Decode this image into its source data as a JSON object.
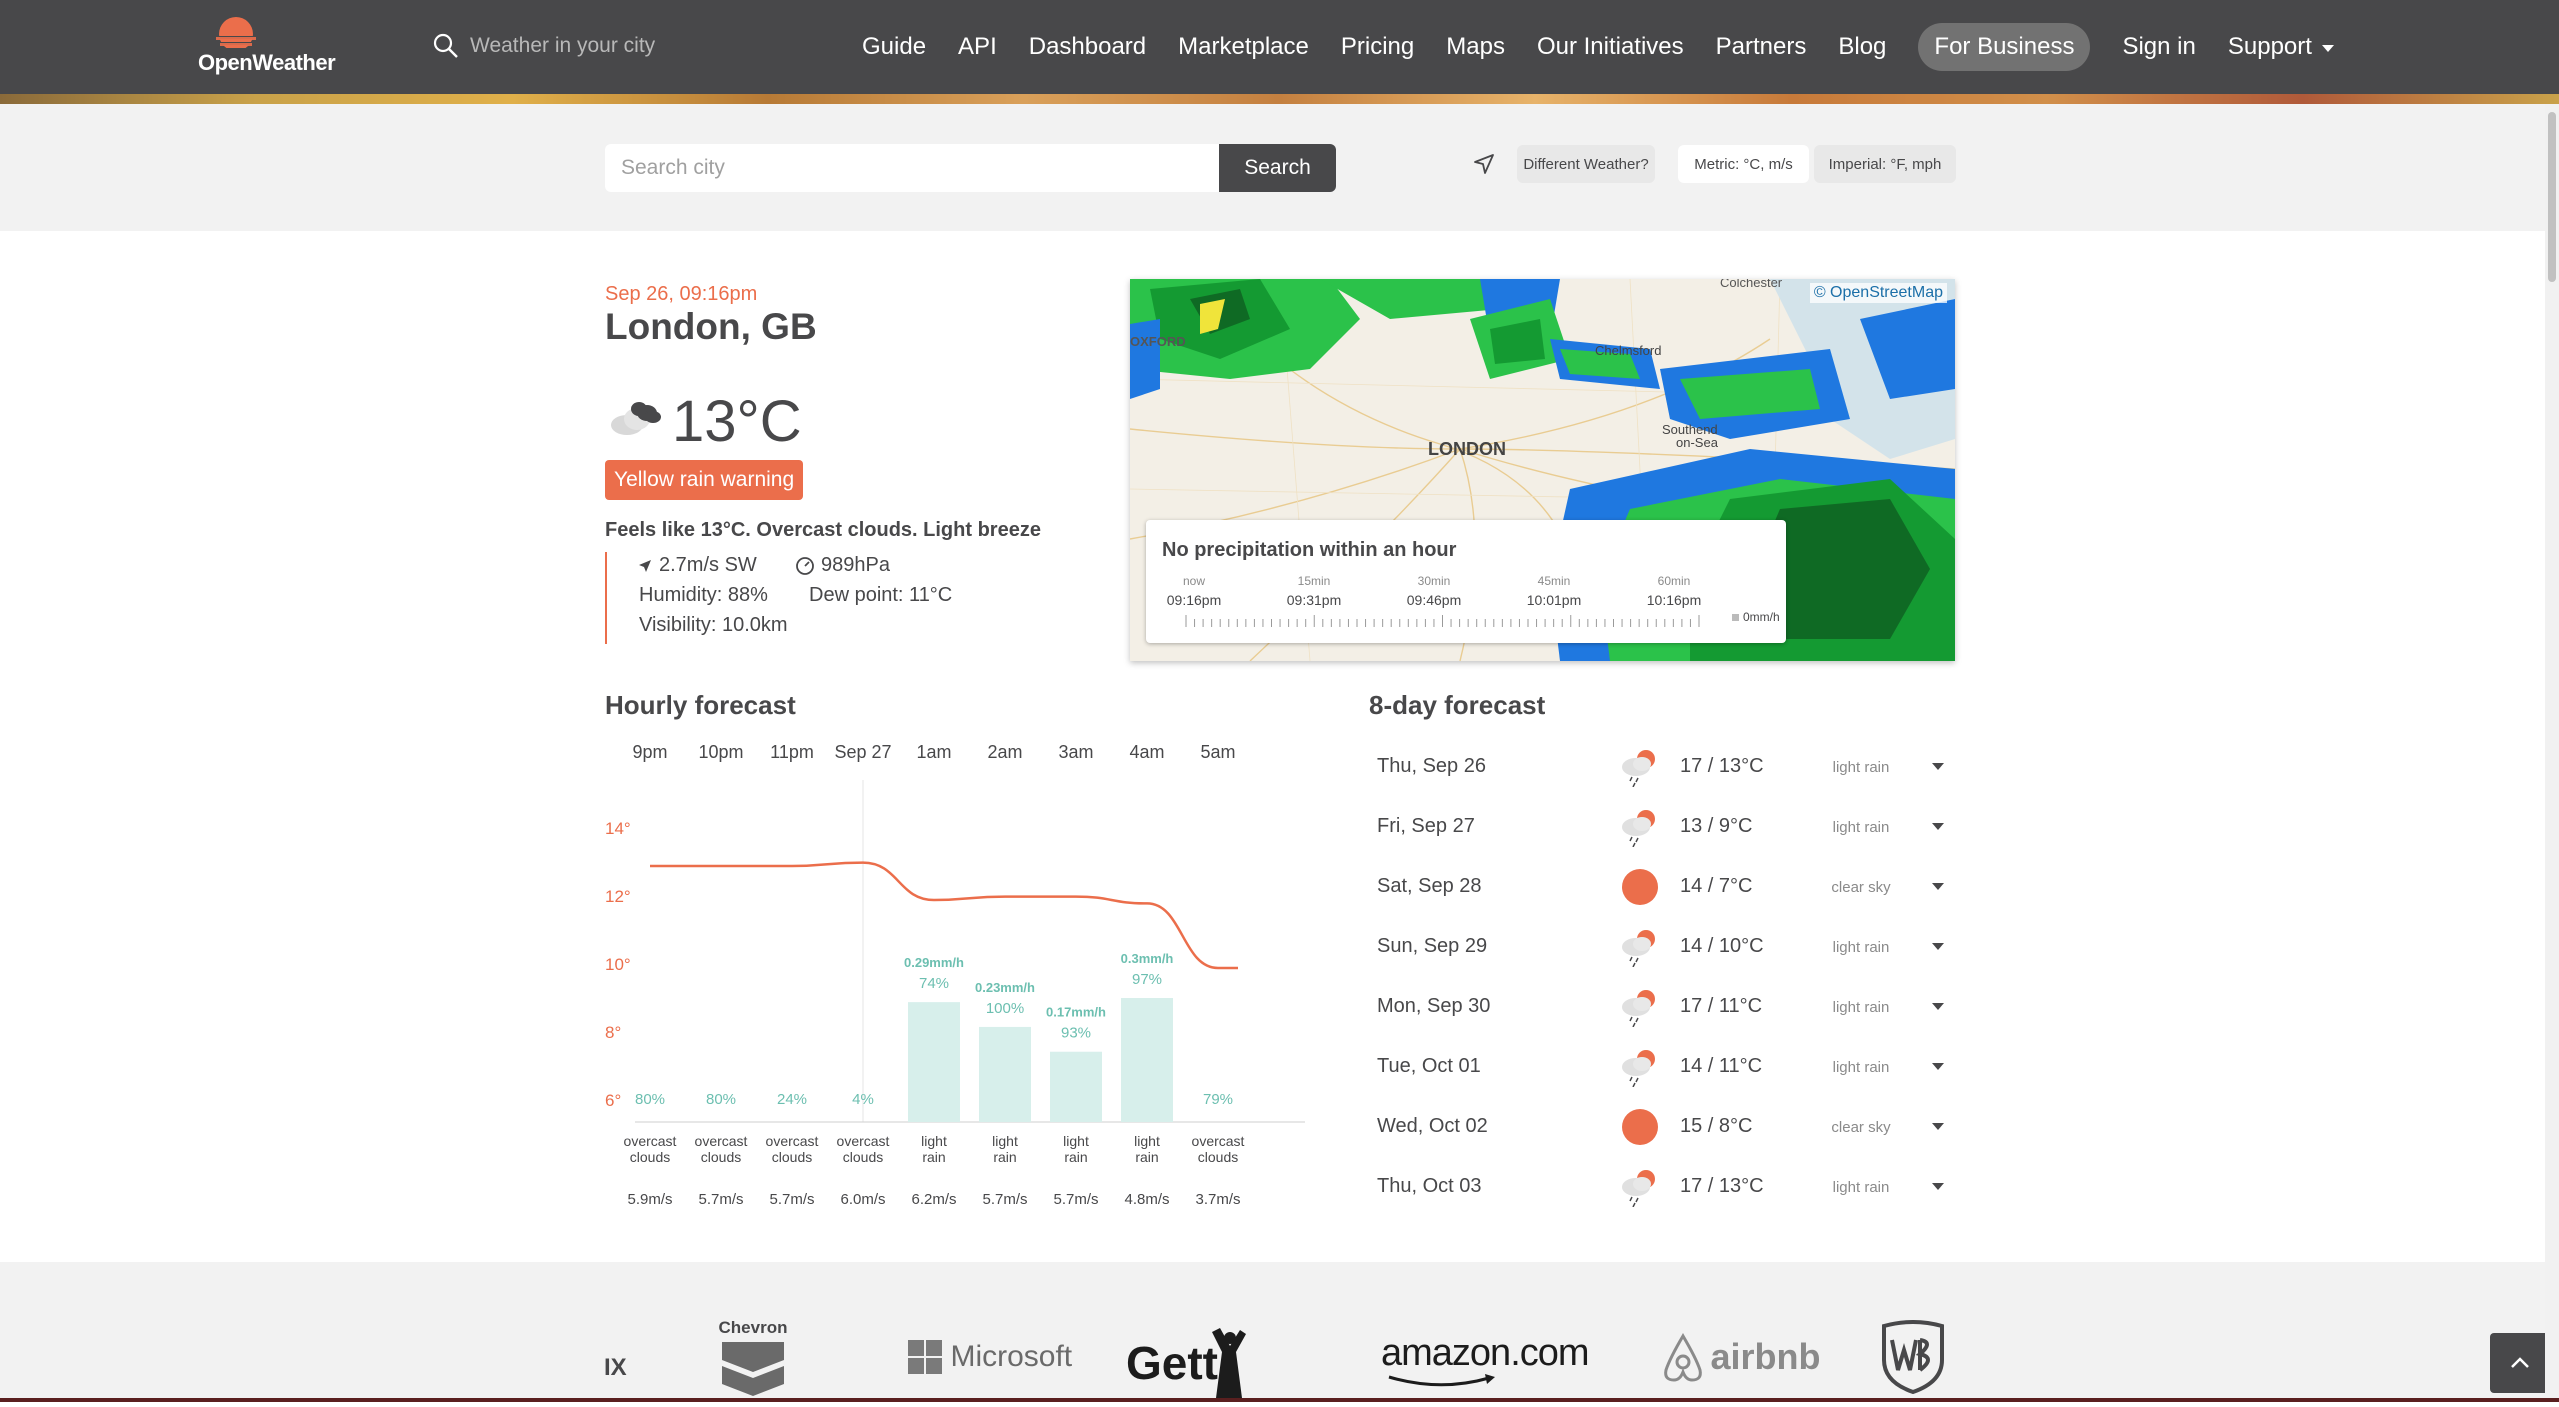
{
  "nav": {
    "logo_text": "OpenWeather",
    "search_placeholder": "Weather in your city",
    "links": [
      "Guide",
      "API",
      "Dashboard",
      "Marketplace",
      "Pricing",
      "Maps",
      "Our Initiatives",
      "Partners",
      "Blog"
    ],
    "business": "For Business",
    "sign_in": "Sign in",
    "support": "Support"
  },
  "search": {
    "placeholder": "Search city",
    "button": "Search",
    "different_weather": "Different Weather?",
    "metric": "Metric: °C, m/s",
    "imperial": "Imperial: °F, mph"
  },
  "current": {
    "datetime": "Sep 26, 09:16pm",
    "city": "London, GB",
    "temp": "13°C",
    "warning": "Yellow rain warning",
    "feels_like": "Feels like 13°C. Overcast clouds. Light breeze",
    "wind": "2.7m/s SW",
    "pressure": "989hPa",
    "humidity": "Humidity: 88%",
    "dew_point": "Dew point: 11°C",
    "visibility": "Visibility: 10.0km"
  },
  "map": {
    "attribution": "© OpenStreetMap",
    "places": [
      "Colchester",
      "OXFORD",
      "Chelmsford",
      "LONDON",
      "Southend",
      "on-Sea"
    ],
    "precip_title": "No precipitation within an hour",
    "precip_labels": [
      "now",
      "15min",
      "30min",
      "45min",
      "60min"
    ],
    "precip_times": [
      "09:16pm",
      "09:31pm",
      "09:46pm",
      "10:01pm",
      "10:16pm"
    ],
    "precip_legend": "0mm/h"
  },
  "hourly": {
    "title": "Hourly forecast",
    "times": [
      "9pm",
      "10pm",
      "11pm",
      "Sep 27",
      "1am",
      "2am",
      "3am",
      "4am",
      "5am"
    ],
    "y_ticks": [
      "14°",
      "12°",
      "10°",
      "8°",
      "6°"
    ],
    "descriptions": [
      [
        "overcast",
        "clouds"
      ],
      [
        "overcast",
        "clouds"
      ],
      [
        "overcast",
        "clouds"
      ],
      [
        "overcast",
        "clouds"
      ],
      [
        "light",
        "rain"
      ],
      [
        "light",
        "rain"
      ],
      [
        "light",
        "rain"
      ],
      [
        "light",
        "rain"
      ],
      [
        "overcast",
        "clouds"
      ]
    ],
    "winds": [
      "5.9m/s",
      "5.7m/s",
      "5.7m/s",
      "6.0m/s",
      "6.2m/s",
      "5.7m/s",
      "5.7m/s",
      "4.8m/s",
      "3.7m/s"
    ]
  },
  "chart_data": {
    "type": "line",
    "x": [
      "9pm",
      "10pm",
      "11pm",
      "Sep 27",
      "1am",
      "2am",
      "3am",
      "4am",
      "5am"
    ],
    "series": [
      {
        "values": [
          13.0,
          13.0,
          13.0,
          13.1,
          12.0,
          12.1,
          12.1,
          11.9,
          10.0
        ]
      }
    ],
    "ylim": [
      5,
      15
    ],
    "precipitation_probability": [
      "80%",
      "80%",
      "24%",
      "4%",
      "74%",
      "100%",
      "93%",
      "97%",
      "79%"
    ],
    "precipitation_amount": [
      null,
      null,
      null,
      null,
      "0.29mm/h",
      "0.23mm/h",
      "0.17mm/h",
      "0.3mm/h",
      null
    ],
    "precipitation_mm_h": [
      0,
      0,
      0,
      0,
      0.29,
      0.23,
      0.17,
      0.3,
      0
    ]
  },
  "daily": {
    "title": "8-day forecast",
    "days": [
      {
        "day": "Thu, Sep 26",
        "temp": "17 / 13°C",
        "desc": "light rain",
        "icon": "rain-icon"
      },
      {
        "day": "Fri, Sep 27",
        "temp": "13 / 9°C",
        "desc": "light rain",
        "icon": "rain-icon"
      },
      {
        "day": "Sat, Sep 28",
        "temp": "14 / 7°C",
        "desc": "clear sky",
        "icon": "sun-icon"
      },
      {
        "day": "Sun, Sep 29",
        "temp": "14 / 10°C",
        "desc": "light rain",
        "icon": "rain-icon"
      },
      {
        "day": "Mon, Sep 30",
        "temp": "17 / 11°C",
        "desc": "light rain",
        "icon": "rain-icon"
      },
      {
        "day": "Tue, Oct 01",
        "temp": "14 / 11°C",
        "desc": "light rain",
        "icon": "rain-icon"
      },
      {
        "day": "Wed, Oct 02",
        "temp": "15 / 8°C",
        "desc": "clear sky",
        "icon": "sun-icon"
      },
      {
        "day": "Thu, Oct 03",
        "temp": "17 / 13°C",
        "desc": "light rain",
        "icon": "rain-icon"
      }
    ]
  },
  "partners": [
    "IX",
    "Chevron",
    "Microsoft",
    "Gett",
    "amazon.com",
    "airbnb",
    "WB"
  ],
  "colors": {
    "accent": "#eb6e4b",
    "dark": "#48484a",
    "rain_bar": "#d7efeb",
    "rain_text": "#6cbfb0"
  }
}
